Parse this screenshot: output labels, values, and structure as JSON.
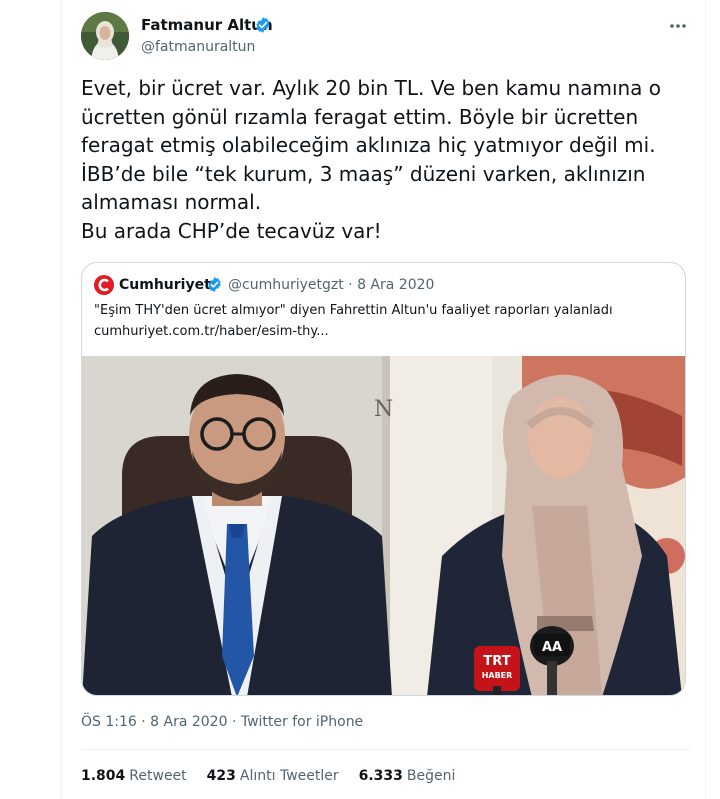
{
  "author": {
    "name": "Fatmanur Altun",
    "handle": "@fatmanuraltun"
  },
  "tweet": {
    "text": "Evet, bir ücret var. Aylık 20 bin TL. Ve ben kamu namına o\nücretten gönül rızamla feragat ettim. Böyle bir ücretten\nferagat etmiş olabileceğim aklınıza hiç yatmıyor değil mi.\nİBB’de bile “tek kurum, 3 maaş” düzeni varken, aklınızın\nalmaması normal.\nBu arada CHP’de tecavüz var!"
  },
  "quote": {
    "name": "Cumhuriyet",
    "handle_date": "@cumhuriyetgzt · 8 Ara 2020",
    "text": "\"Eşim THY'den ücret almıyor\" diyen Fahrettin Altun'u faaliyet raporları yalanladı\ncumhuriyet.com.tr/haber/esim-thy..."
  },
  "meta": {
    "timestamp": "ÖS 1:16 · 8 Ara 2020 · Twitter for iPhone"
  },
  "stats": {
    "retweets_count": "1.804",
    "retweets_label": "Retweet",
    "quotes_count": "423",
    "quotes_label": "Alıntı Tweetler",
    "likes_count": "6.333",
    "likes_label": "Beğeni"
  },
  "microphones": {
    "trt_line1": "TRT",
    "trt_line2": "HABER",
    "aa": "AA"
  },
  "colors": {
    "verified": "#1d9bf0",
    "cumhuriyet_red": "#e11d24",
    "text_primary": "#0f1419",
    "text_secondary": "#536471"
  },
  "icons": [
    "verified-badge-icon",
    "more-icon",
    "cumhuriyet-logo-icon"
  ]
}
